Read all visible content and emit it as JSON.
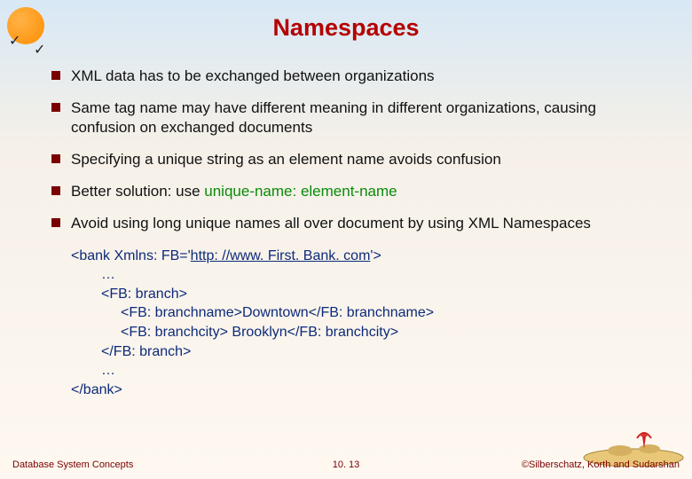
{
  "title": "Namespaces",
  "bullets": {
    "b1": "XML data has to be exchanged between organizations",
    "b2": "Same tag name may have different meaning in different organizations, causing confusion on exchanged documents",
    "b3": "Specifying a unique string as an element name avoids confusion",
    "b4_prefix": "Better solution: use  ",
    "b4_unique": "unique-name: element-name",
    "b5": "Avoid using long unique names all over document by using XML Namespaces"
  },
  "code": {
    "l1a": "<bank Xmlns: FB='",
    "l1b": "http: //www. First. Bank. com",
    "l1c": "'>",
    "l2": "…",
    "l3": "<FB: branch>",
    "l4": "<FB: branchname>Downtown</FB: branchname>",
    "l5": "<FB: branchcity> Brooklyn</FB: branchcity>",
    "l6": "</FB: branch>",
    "l7": "…",
    "l8": "</bank>"
  },
  "footer": {
    "left": "Database System Concepts",
    "center": "10. 13",
    "right": "©Silberschatz, Korth and Sudarshan"
  }
}
